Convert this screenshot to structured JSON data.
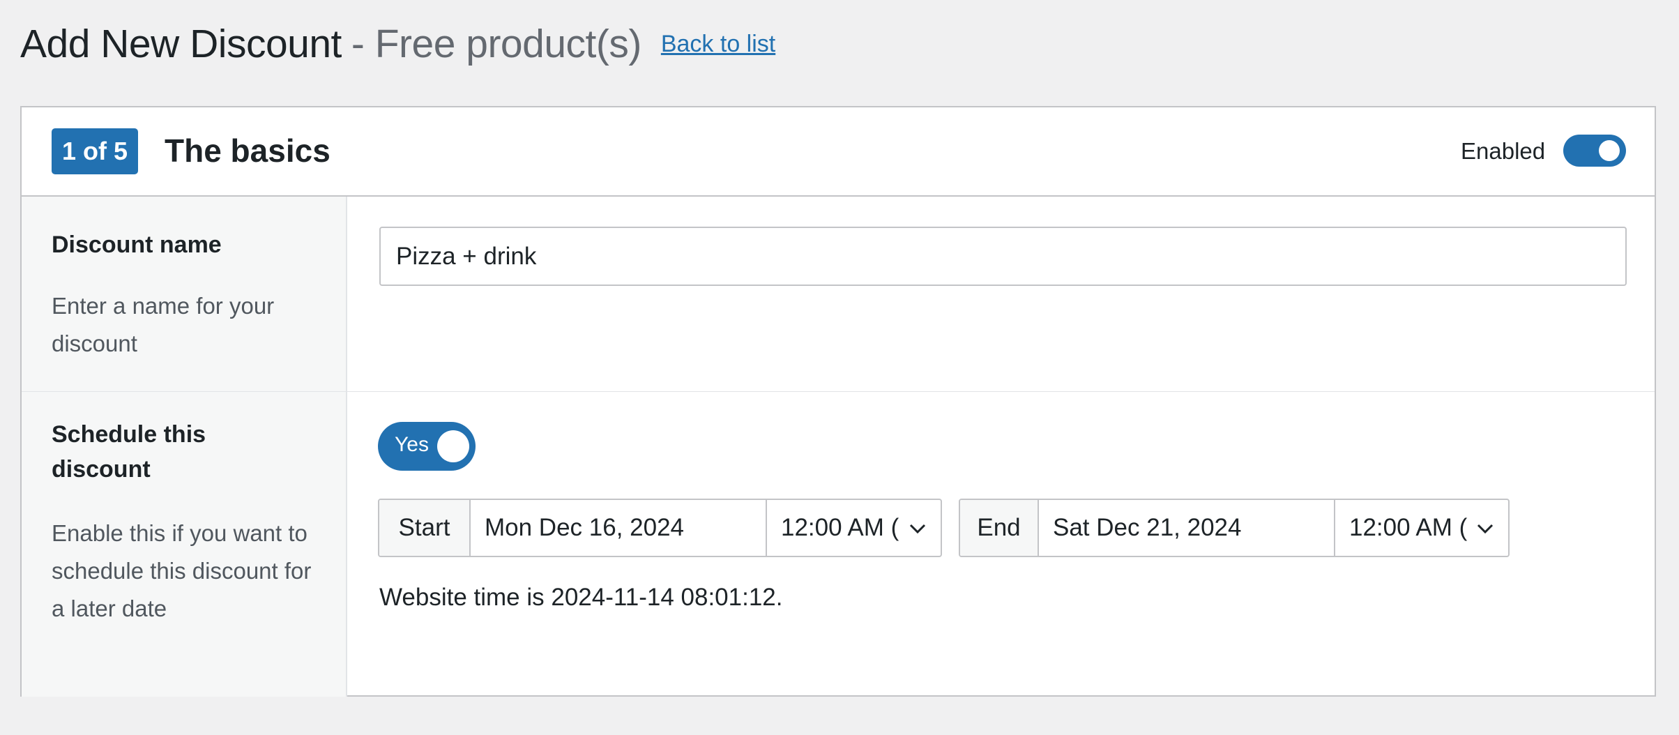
{
  "header": {
    "title": "Add New Discount",
    "subtitle": "- Free product(s)",
    "back_link": "Back to list"
  },
  "section": {
    "step_badge": "1 of 5",
    "title": "The basics",
    "enabled_label": "Enabled",
    "enabled": true
  },
  "discount_name": {
    "label": "Discount name",
    "description": "Enter a name for your discount",
    "value": "Pizza + drink"
  },
  "schedule": {
    "label": "Schedule this discount",
    "description": "Enable this if you want to schedule this discount for a later date",
    "toggle_label": "Yes",
    "enabled": true,
    "start": {
      "addon": "Start",
      "date": "Mon Dec 16, 2024",
      "time": "12:00 AM ("
    },
    "end": {
      "addon": "End",
      "date": "Sat Dec 21, 2024",
      "time": "12:00 AM ("
    },
    "website_time": "Website time is 2024-11-14 08:01:12."
  },
  "colors": {
    "accent": "#2271b1",
    "background": "#f0f0f1",
    "border": "#c3c4c7"
  }
}
